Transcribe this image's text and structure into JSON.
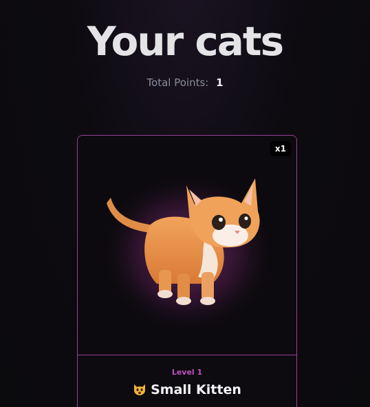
{
  "header": {
    "title": "Your cats"
  },
  "points": {
    "label": "Total Points:",
    "value": "1"
  },
  "cards": [
    {
      "badge": "x1",
      "level": "Level 1",
      "name": "Small Kitten",
      "emoji_icon": "cat-face-icon",
      "image": "orange-kitten-illustration"
    }
  ],
  "colors": {
    "accent_border": "#9b3f9a",
    "level_text": "#c04fc3",
    "background": "#0b0a0d"
  }
}
